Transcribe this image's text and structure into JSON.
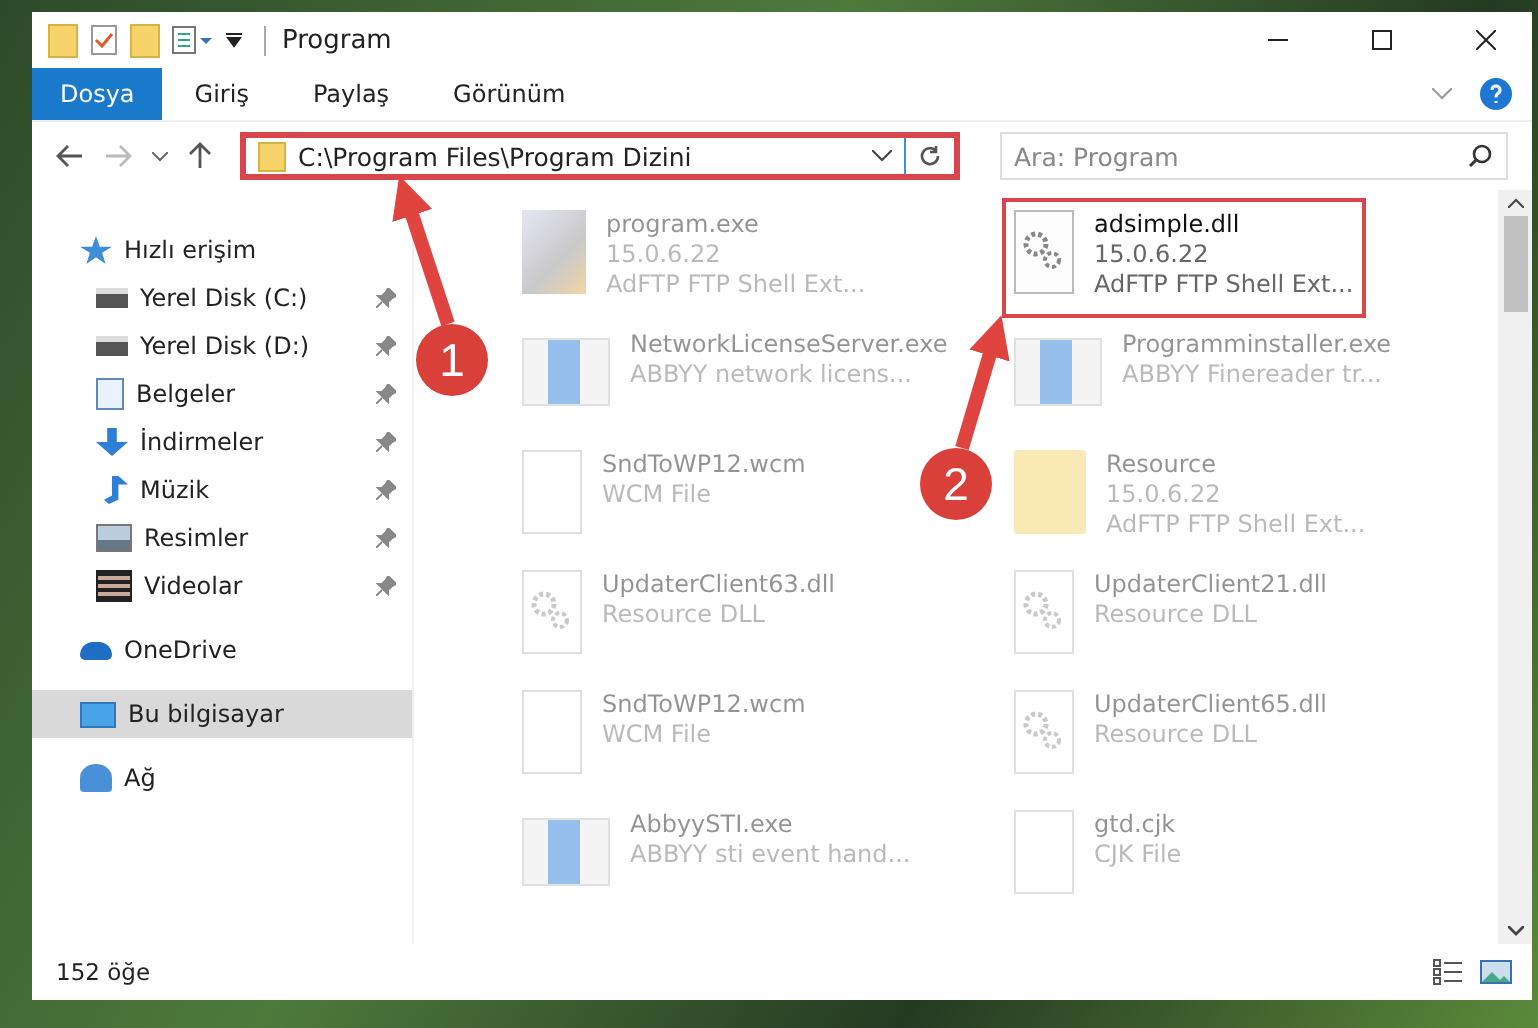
{
  "window": {
    "title": "Program"
  },
  "ribbon_tabs": [
    {
      "label": "Dosya",
      "selected": true
    },
    {
      "label": "Giriş",
      "selected": false
    },
    {
      "label": "Paylaş",
      "selected": false
    },
    {
      "label": "Görünüm",
      "selected": false
    }
  ],
  "address_bar": {
    "path": "C:\\Program Files\\Program Dizini",
    "highlighted": true
  },
  "search": {
    "placeholder": "Ara: Program"
  },
  "sidebar": {
    "items": [
      {
        "label": "Hızlı erişim",
        "kind": "star",
        "pinned": false,
        "selected": false,
        "children": [
          {
            "label": "Yerel Disk (C:)",
            "kind": "drive",
            "pinned": true,
            "selected": false
          },
          {
            "label": "Yerel Disk (D:)",
            "kind": "drive",
            "pinned": true,
            "selected": false
          },
          {
            "label": "Belgeler",
            "kind": "doc",
            "pinned": true,
            "selected": false
          },
          {
            "label": "İndirmeler",
            "kind": "download",
            "pinned": true,
            "selected": false
          },
          {
            "label": "Müzik",
            "kind": "music",
            "pinned": true,
            "selected": false
          },
          {
            "label": "Resimler",
            "kind": "picture",
            "pinned": true,
            "selected": false
          },
          {
            "label": "Videolar",
            "kind": "film",
            "pinned": true,
            "selected": false
          }
        ]
      },
      {
        "label": "OneDrive",
        "kind": "cloud",
        "pinned": false,
        "selected": false
      },
      {
        "label": "Bu bilgisayar",
        "kind": "computer",
        "pinned": false,
        "selected": true
      },
      {
        "label": "Ağ",
        "kind": "network",
        "pinned": false,
        "selected": false
      }
    ]
  },
  "files": [
    {
      "name": "program.exe",
      "details": [
        "15.0.6.22",
        "AdFTP FTP Shell Ext..."
      ],
      "kind": "installer",
      "faded": true,
      "highlighted": false
    },
    {
      "name": "adsimple.dll",
      "details": [
        "15.0.6.22",
        "AdFTP FTP Shell Ext..."
      ],
      "kind": "dll",
      "faded": false,
      "highlighted": true
    },
    {
      "name": "NetworkLicenseServer.exe",
      "details": [
        "ABBYY network licens..."
      ],
      "kind": "app",
      "faded": true,
      "highlighted": false
    },
    {
      "name": "Programminstaller.exe",
      "details": [
        "ABBYY Finereader tr..."
      ],
      "kind": "app",
      "faded": true,
      "highlighted": false
    },
    {
      "name": "SndToWP12.wcm",
      "details": [
        "WCM File"
      ],
      "kind": "file",
      "faded": true,
      "highlighted": false
    },
    {
      "name": "Resource",
      "details": [
        "15.0.6.22",
        "AdFTP FTP Shell Ext..."
      ],
      "kind": "folder",
      "faded": true,
      "highlighted": false
    },
    {
      "name": "UpdaterClient63.dll",
      "details": [
        "Resource DLL"
      ],
      "kind": "dll",
      "faded": true,
      "highlighted": false
    },
    {
      "name": "UpdaterClient21.dll",
      "details": [
        "Resource DLL"
      ],
      "kind": "dll",
      "faded": true,
      "highlighted": false
    },
    {
      "name": "SndToWP12.wcm",
      "details": [
        "WCM File"
      ],
      "kind": "file",
      "faded": true,
      "highlighted": false
    },
    {
      "name": "UpdaterClient65.dll",
      "details": [
        "Resource DLL"
      ],
      "kind": "dll",
      "faded": true,
      "highlighted": false
    },
    {
      "name": "AbbyySTI.exe",
      "details": [
        "ABBYY sti event hand..."
      ],
      "kind": "app",
      "faded": true,
      "highlighted": false
    },
    {
      "name": "gtd.cjk",
      "details": [
        "CJK File"
      ],
      "kind": "file",
      "faded": true,
      "highlighted": false
    }
  ],
  "callouts": [
    {
      "label": "1"
    },
    {
      "label": "2"
    }
  ],
  "status_bar": {
    "count": "152 öğe"
  }
}
